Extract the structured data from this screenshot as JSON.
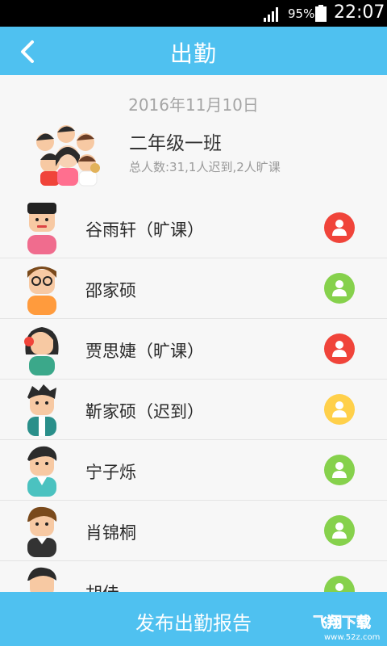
{
  "status_bar": {
    "battery": "95%",
    "time": "22:07"
  },
  "header": {
    "title": "出勤"
  },
  "class_info": {
    "date": "2016年11月10日",
    "name": "二年级一班",
    "summary": "总人数:31,1人迟到,2人旷课"
  },
  "students": [
    {
      "name": "谷雨轩（旷课）",
      "status_color": "#f0443a"
    },
    {
      "name": "邵家硕",
      "status_color": "#86d14c"
    },
    {
      "name": "贾思婕（旷课）",
      "status_color": "#f0443a"
    },
    {
      "name": "靳家硕（迟到）",
      "status_color": "#ffd04a"
    },
    {
      "name": "宁子烁",
      "status_color": "#86d14c"
    },
    {
      "name": "肖锦桐",
      "status_color": "#86d14c"
    },
    {
      "name": "胡佳",
      "status_color": "#86d14c"
    }
  ],
  "footer": {
    "publish_label": "发布出勤报告"
  },
  "watermark": {
    "text": "飞翔下载",
    "url": "www.52z.com"
  },
  "colors": {
    "accent": "#4fc1f0",
    "absent": "#f0443a",
    "present": "#86d14c",
    "late": "#ffd04a"
  }
}
